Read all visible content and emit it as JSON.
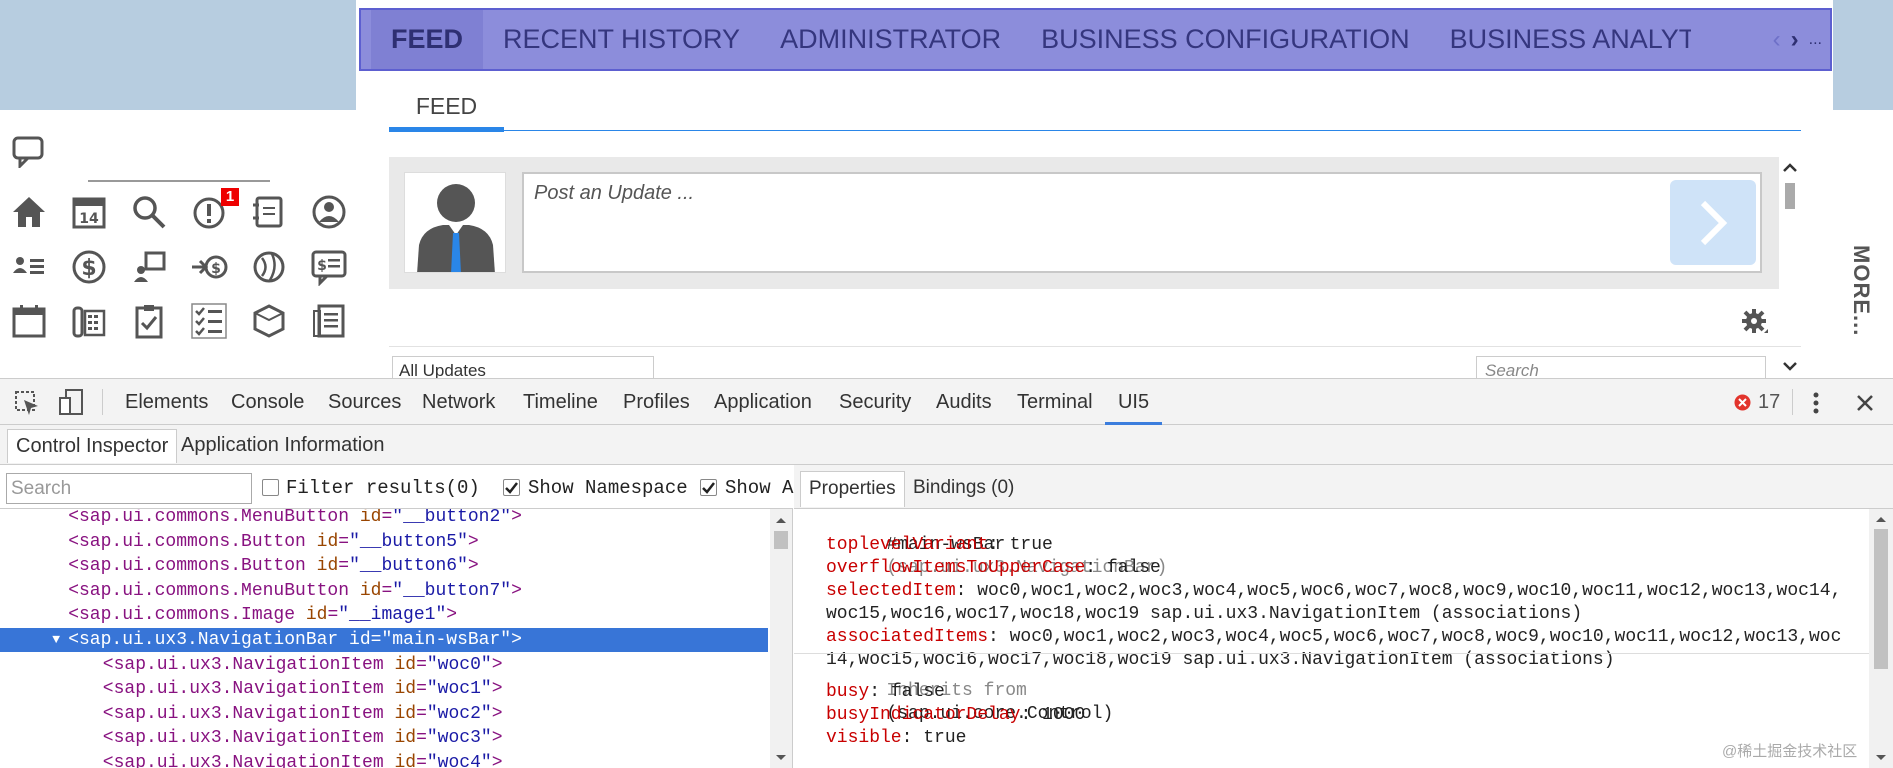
{
  "nav": {
    "items": [
      "FEED",
      "RECENT HISTORY",
      "ADMINISTRATOR",
      "BUSINESS CONFIGURATION",
      "BUSINESS ANALYTICS"
    ],
    "overflow_label": "...",
    "more_label": "MORE..."
  },
  "feed": {
    "tab_label": "FEED",
    "post_placeholder": "Post an Update ...",
    "filter_value": "All Updates",
    "search_placeholder": "Search"
  },
  "notification_count": "1",
  "devtools": {
    "tabs": [
      "Elements",
      "Console",
      "Sources",
      "Network",
      "Timeline",
      "Profiles",
      "Application",
      "Security",
      "Audits",
      "Terminal",
      "UI5"
    ],
    "active_tab": "UI5",
    "error_count": "17",
    "subtabs": [
      "Control Inspector",
      "Application Information"
    ],
    "search_placeholder": "Search",
    "filter_label": "Filter results(0)",
    "show_namespace_label": "Show Namespace",
    "show_attr_label": "Show A",
    "right_tabs": [
      "Properties",
      "Bindings (0)"
    ]
  },
  "tree": [
    {
      "indent": 4,
      "tag": "sap.ui.commons.MenuButton",
      "id": "__button2",
      "cut": true
    },
    {
      "indent": 4,
      "tag": "sap.ui.commons.Button",
      "id": "__button5"
    },
    {
      "indent": 4,
      "tag": "sap.ui.commons.Button",
      "id": "__button6"
    },
    {
      "indent": 4,
      "tag": "sap.ui.commons.MenuButton",
      "id": "__button7"
    },
    {
      "indent": 4,
      "tag": "sap.ui.commons.Image",
      "id": "__image1"
    },
    {
      "indent": 4,
      "tag": "sap.ui.ux3.NavigationBar",
      "id": "main-wsBar",
      "selected": true,
      "expanded": true
    },
    {
      "indent": 6,
      "tag": "sap.ui.ux3.NavigationItem",
      "id": "woc0"
    },
    {
      "indent": 6,
      "tag": "sap.ui.ux3.NavigationItem",
      "id": "woc1"
    },
    {
      "indent": 6,
      "tag": "sap.ui.ux3.NavigationItem",
      "id": "woc2"
    },
    {
      "indent": 6,
      "tag": "sap.ui.ux3.NavigationItem",
      "id": "woc3"
    },
    {
      "indent": 6,
      "tag": "sap.ui.ux3.NavigationItem",
      "id": "woc4"
    }
  ],
  "properties": {
    "heading_id": "#main-wsBar",
    "heading_type": "(sap.ui.ux3.NavigationBar)",
    "rows": [
      {
        "key": "toplevelVariant",
        "value": "true"
      },
      {
        "key": "overflowItemsToUpperCase",
        "value": "false"
      },
      {
        "key": "selectedItem",
        "value": "woc0,woc1,woc2,woc3,woc4,woc5,woc6,woc7,woc8,woc9,woc10,woc11,woc12,woc13,woc14,",
        "value2": "woc15,woc16,woc17,woc18,woc19 sap.ui.ux3.NavigationItem (associations)"
      },
      {
        "key": "associatedItems",
        "value": "woc0,woc1,woc2,woc3,woc4,woc5,woc6,woc7,woc8,woc9,woc10,woc11,woc12,woc13,woc",
        "value2": "14,woc15,woc16,woc17,woc18,woc19 sap.ui.ux3.NavigationItem (associations)"
      }
    ],
    "inherits_label": "Inherits from",
    "inherits_type": "(sap.ui.core.Control)",
    "inherited_rows": [
      {
        "key": "busy",
        "value": "false"
      },
      {
        "key": "busyIndicatorDelay",
        "value": "1000"
      },
      {
        "key": "visible",
        "value": "true"
      }
    ]
  },
  "watermark": "@稀土掘金技术社区",
  "colors": {
    "navbar": "#8c8ddb",
    "accent": "#2a86e8",
    "selected_row": "#3875d7"
  }
}
